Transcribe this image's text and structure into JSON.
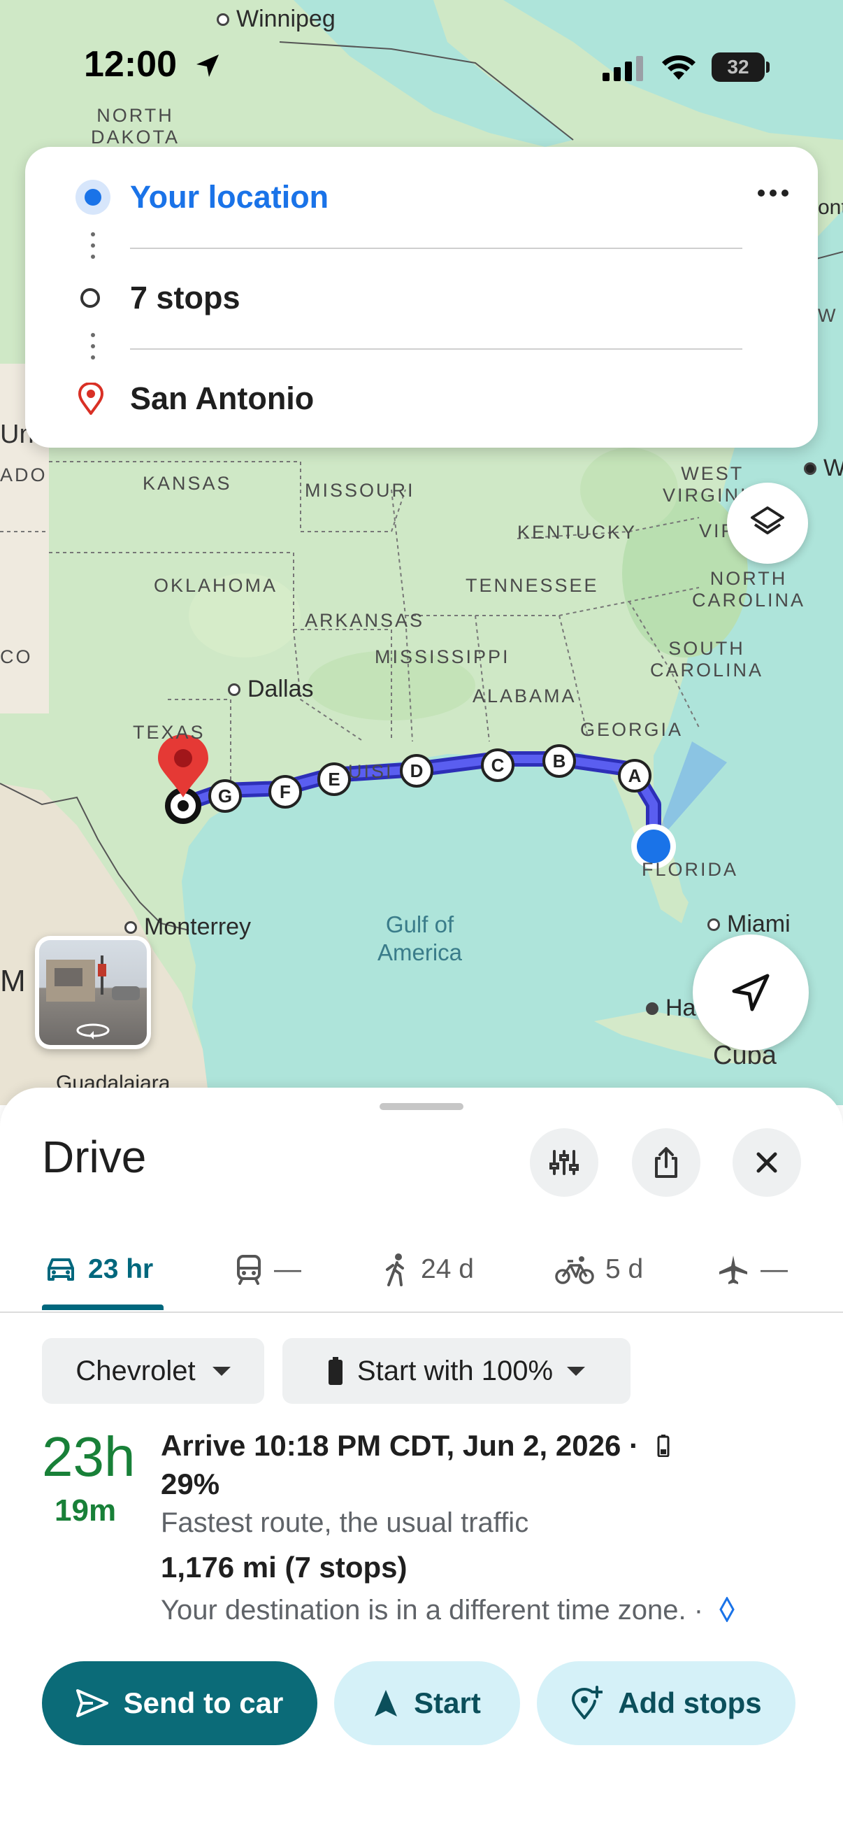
{
  "status_bar": {
    "time": "12:00",
    "battery": "32"
  },
  "route_card": {
    "origin": "Your location",
    "stops": "7 stops",
    "destination": "San Antonio",
    "more_icon": "more-horizontal-icon"
  },
  "map": {
    "labels": {
      "winnipeg": "Winnipeg",
      "north_dakota": "NORTH\nDAKOTA",
      "kansas": "KANSAS",
      "missouri": "MISSOURI",
      "kentucky": "KENTUCKY",
      "west_virginia": "WEST\nVIRGINIA",
      "vir": "VIR",
      "oklahoma": "OKLAHOMA",
      "tennessee": "TENNESSEE",
      "north_carolina": "NORTH\nCAROLINA",
      "arkansas": "ARKANSAS",
      "mississippi": "MISSISSIPPI",
      "south_carolina": "SOUTH\nCAROLINA",
      "co": "CO",
      "ado": "ADO",
      "dallas": "Dallas",
      "alabama": "ALABAMA",
      "georgia": "GEORGIA",
      "texas": "TEXAS",
      "louisiana": "UISI",
      "florida": "FLORIDA",
      "gulf": "Gulf of\nAmerica",
      "monterrey": "Monterrey",
      "miami": "Miami",
      "havana": "Ha",
      "cuba": "Cuba",
      "mexico": "M",
      "guadalajara": "Guadalajara",
      "united_states": "United States",
      "edge_w": "W",
      "edge_ont": "ont",
      "edge_ny": "W Y"
    },
    "stop_markers": [
      "A",
      "B",
      "C",
      "D",
      "E",
      "F",
      "G"
    ],
    "route_color": "#3b3fd9",
    "accent_blue": "#1a73e8",
    "destination_pin_color": "#e53935"
  },
  "sheet": {
    "title": "Drive",
    "modes": [
      {
        "icon": "car-icon",
        "label": "23 hr"
      },
      {
        "icon": "transit-icon",
        "label": "—"
      },
      {
        "icon": "walk-icon",
        "label": "24 d"
      },
      {
        "icon": "bike-icon",
        "label": "5 d"
      },
      {
        "icon": "flight-icon",
        "label": "—"
      }
    ],
    "vehicle_chip": "Chevrolet",
    "battery_chip": "Start with 100%",
    "eta_hours": "23h",
    "eta_minutes": "19m",
    "arrive": "Arrive 10:18 PM CDT, Jun 2, 2026 ·",
    "battery_pct": "29%",
    "route_desc": "Fastest route, the usual traffic",
    "distance": "1,176 mi (7 stops)",
    "tz_note": "Your destination is in a different time zone. ·",
    "buttons": {
      "send": "Send to car",
      "start": "Start",
      "add_stops": "Add stops"
    },
    "accent": "#00677d",
    "eta_color": "#188038"
  }
}
